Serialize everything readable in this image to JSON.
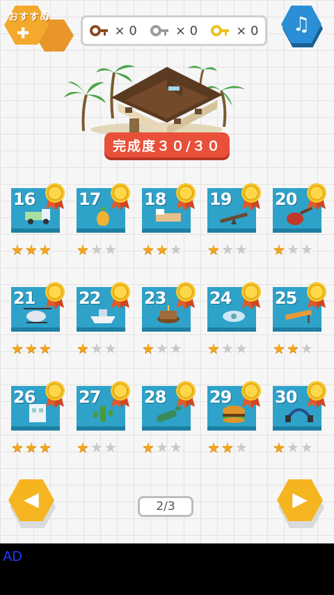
{
  "header": {
    "recommend_label": "おすすめ",
    "keys": [
      {
        "icon": "bronze-key-icon",
        "color": "#8a4a22",
        "count_label": "× 0"
      },
      {
        "icon": "silver-key-icon",
        "color": "#9a9a9a",
        "count_label": "× 0"
      },
      {
        "icon": "gold-key-icon",
        "color": "#f0c020",
        "count_label": "× 0"
      }
    ],
    "music_icon": "music-note-icon"
  },
  "progress": {
    "completion_label": "完成度３０/３０"
  },
  "levels": [
    {
      "number": "16",
      "stars": 3,
      "icon": "truck-icon"
    },
    {
      "number": "17",
      "stars": 1,
      "icon": "pineapple-icon"
    },
    {
      "number": "18",
      "stars": 2,
      "icon": "bed-icon"
    },
    {
      "number": "19",
      "stars": 1,
      "icon": "seesaw-icon"
    },
    {
      "number": "20",
      "stars": 1,
      "icon": "guitar-icon"
    },
    {
      "number": "21",
      "stars": 3,
      "icon": "helicopter-icon"
    },
    {
      "number": "22",
      "stars": 1,
      "icon": "ship-icon"
    },
    {
      "number": "23",
      "stars": 1,
      "icon": "cake-icon"
    },
    {
      "number": "24",
      "stars": 1,
      "icon": "fan-icon"
    },
    {
      "number": "25",
      "stars": 2,
      "icon": "bench-icon"
    },
    {
      "number": "26",
      "stars": 3,
      "icon": "building-icon"
    },
    {
      "number": "27",
      "stars": 1,
      "icon": "cactus-icon"
    },
    {
      "number": "28",
      "stars": 1,
      "icon": "bottle-icon"
    },
    {
      "number": "29",
      "stars": 2,
      "icon": "burger-icon"
    },
    {
      "number": "30",
      "stars": 1,
      "icon": "headphones-icon"
    }
  ],
  "pager": {
    "label": "2/3"
  },
  "nav": {
    "prev_icon": "prev-arrow-icon",
    "next_icon": "next-arrow-icon"
  },
  "ad": {
    "label": "AD"
  },
  "colors": {
    "tile": "#2fa2c9",
    "star_on": "#f2a51f",
    "star_off": "#c9c9c9",
    "banner": "#e8503a"
  }
}
